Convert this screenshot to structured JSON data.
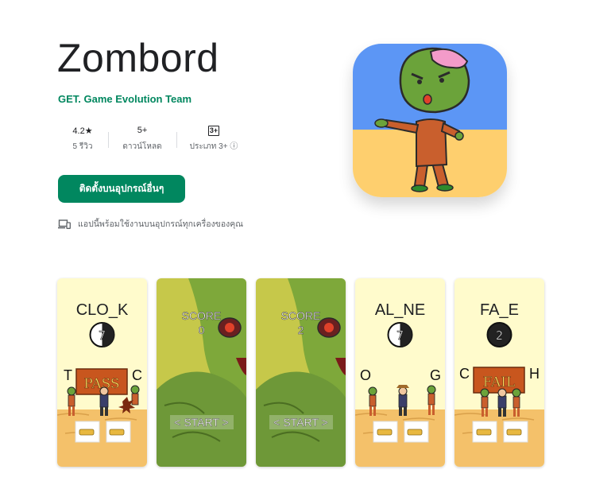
{
  "app": {
    "title": "Zombord",
    "developer": "GET. Game Evolution Team",
    "install_label": "ติดตั้งบนอุปกรณ์อื่นๆ",
    "devices_note": "แอปนี้พร้อมใช้งานบนอุปกรณ์ทุกเครื่องของคุณ",
    "brand_color": "#01875f"
  },
  "stats": [
    {
      "value": "4.2★",
      "label": "5 รีวิว"
    },
    {
      "value": "5+",
      "label": "ดาวน์โหลด"
    },
    {
      "value": "3+",
      "label": "ประเภท 3+ ⓘ"
    }
  ],
  "screenshots": [
    {
      "word": "CLO_K",
      "timer": "7",
      "left": "T",
      "right": "C",
      "banner": "PASS"
    },
    {
      "score_label": "SCORE",
      "score": "0",
      "button": "< START >"
    },
    {
      "score_label": "SCORE",
      "score": "2",
      "button": "< START >"
    },
    {
      "word": "AL_NE",
      "timer": "7",
      "left": "O",
      "right": "G"
    },
    {
      "word": "FA_E",
      "timer": "2",
      "left": "C",
      "right": "H",
      "banner": "FAIL"
    }
  ]
}
